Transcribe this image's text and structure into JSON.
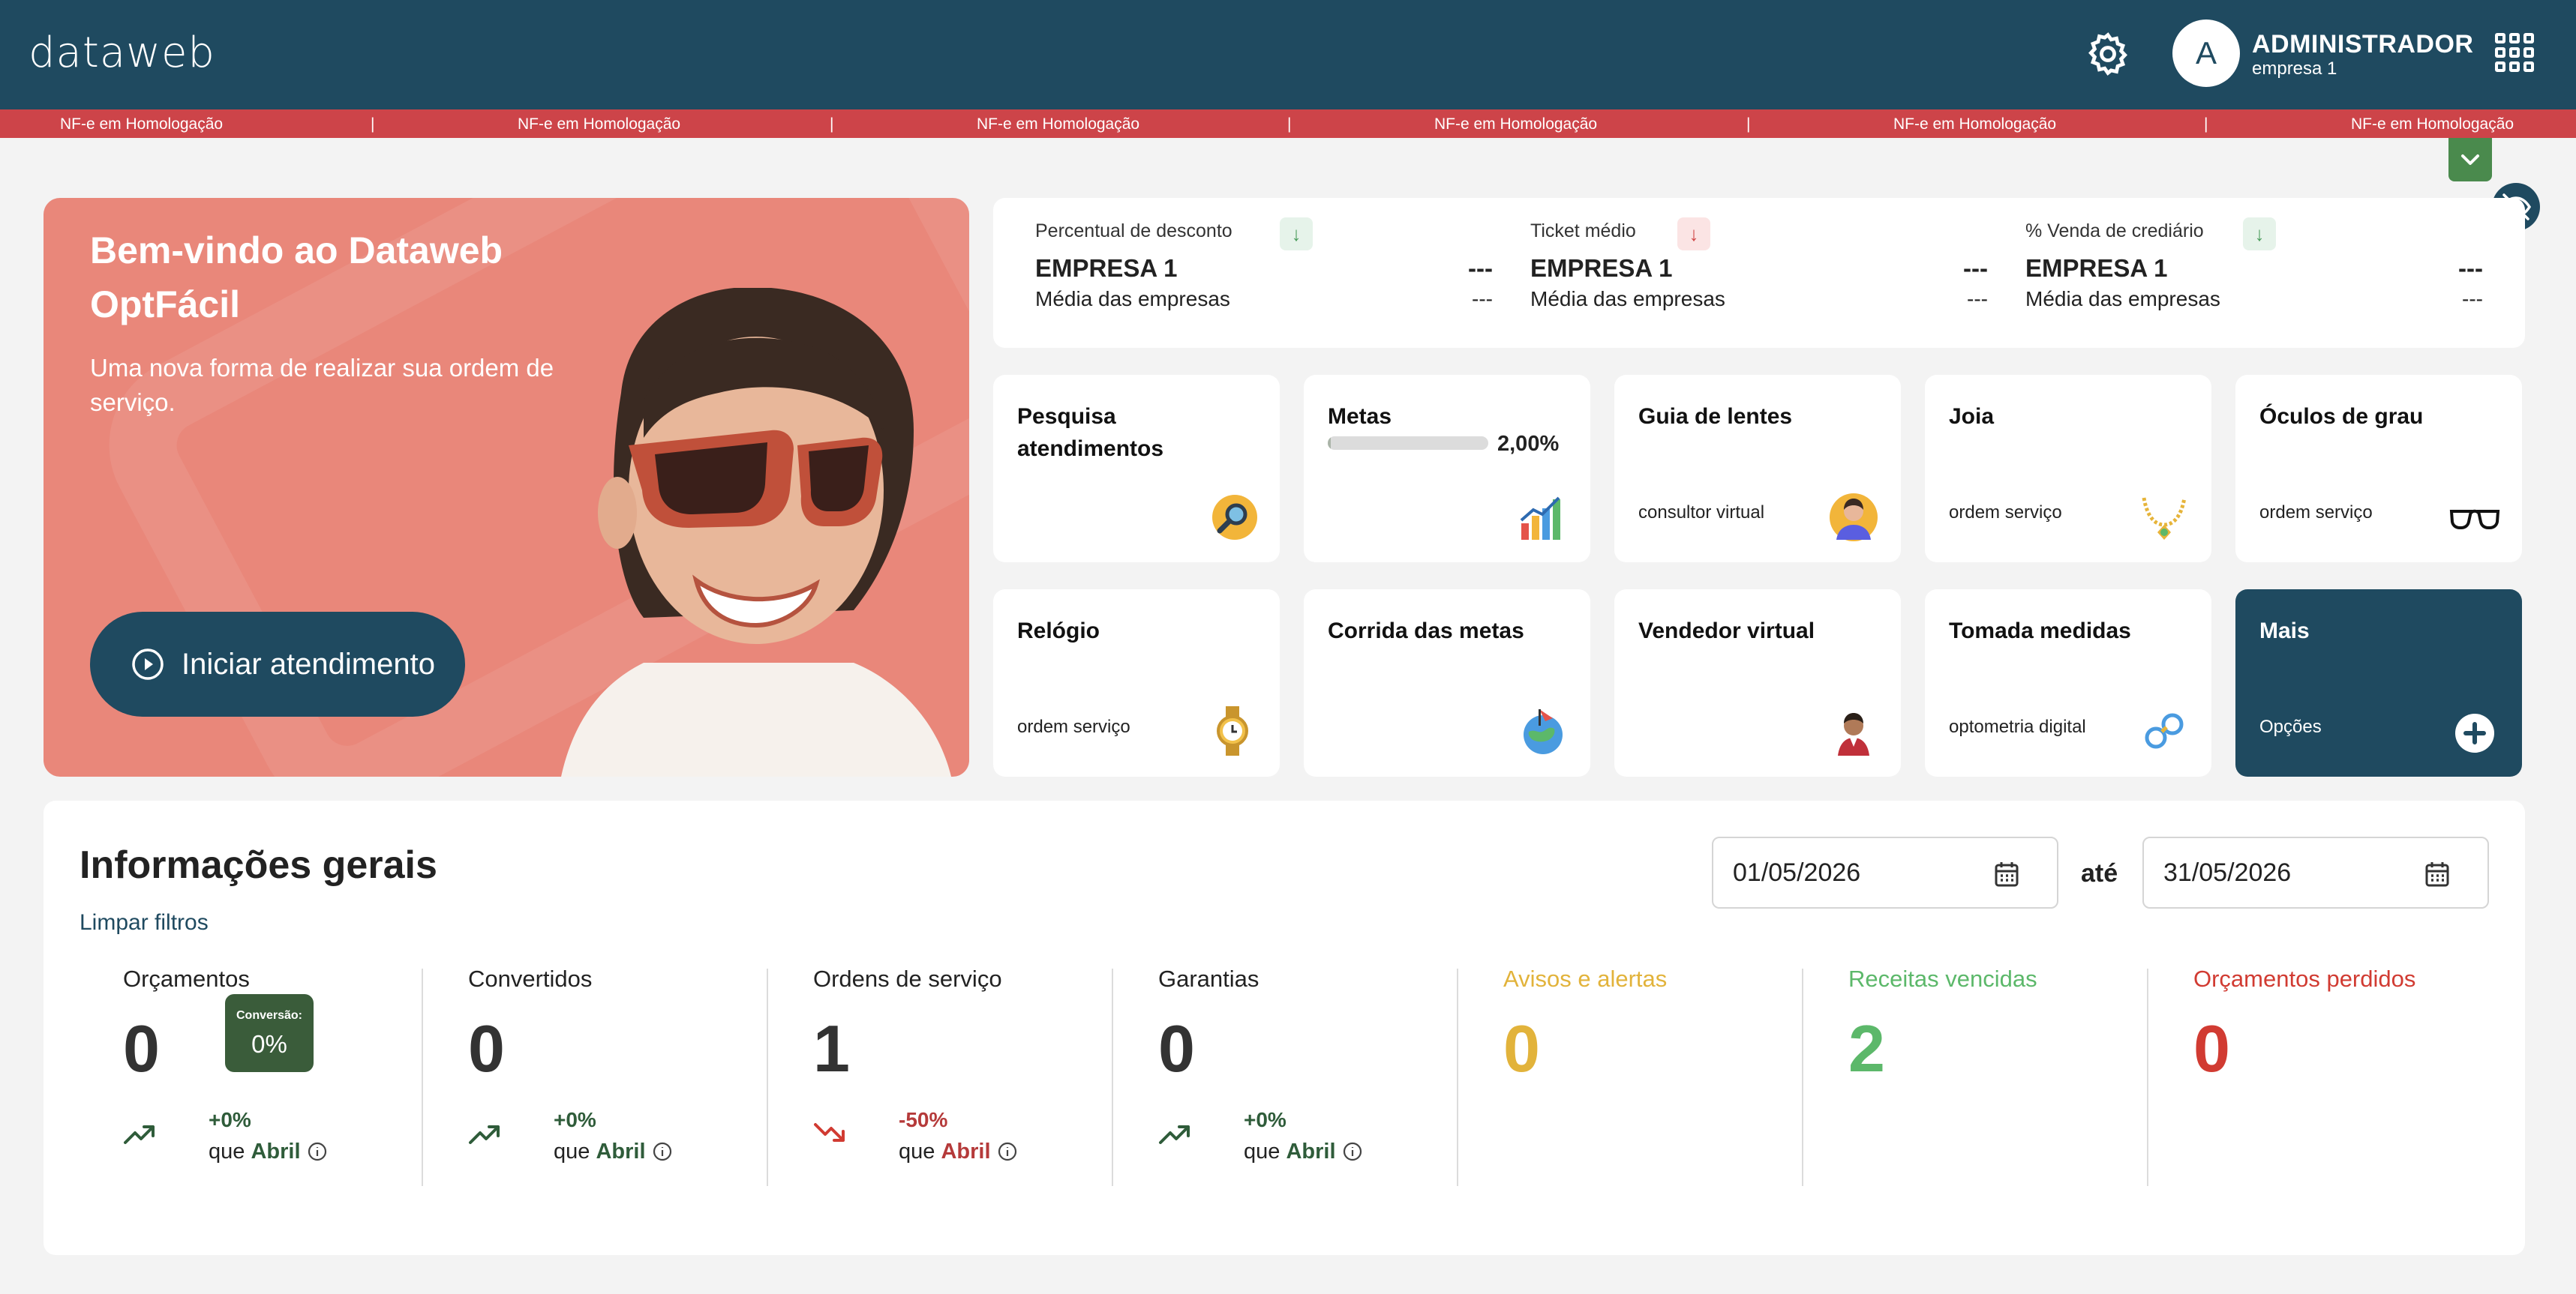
{
  "header": {
    "logo": "dataweb",
    "user_initial": "A",
    "user_name": "ADMINISTRADOR",
    "user_company": "empresa 1"
  },
  "strip": {
    "items": [
      "NF-e em Homologação",
      "NF-e em Homologação",
      "NF-e em Homologação",
      "NF-e em Homologação",
      "NF-e em Homologação",
      "NF-e em Homologação"
    ],
    "separator": "|"
  },
  "hero": {
    "title": "Bem-vindo ao Dataweb OptFácil",
    "subtitle": "Uma nova forma de realizar sua ordem de serviço.",
    "button_label": "Iniciar atendimento"
  },
  "kpis": [
    {
      "label": "Percentual de desconto",
      "company": "EMPRESA 1",
      "company_value": "---",
      "avg_label": "Média das empresas",
      "avg_value": "---",
      "arrow": "↓"
    },
    {
      "label": "Ticket médio",
      "company": "EMPRESA 1",
      "company_value": "---",
      "avg_label": "Média das empresas",
      "avg_value": "---",
      "arrow": "↓"
    },
    {
      "label": "% Venda de crediário",
      "company": "EMPRESA 1",
      "company_value": "---",
      "avg_label": "Média das empresas",
      "avg_value": "---",
      "arrow": "↓"
    }
  ],
  "tiles": {
    "pesquisa": {
      "title": "Pesquisa atendimentos"
    },
    "metas": {
      "title": "Metas",
      "progress": 0.02,
      "progress_label": "2,00%"
    },
    "guia": {
      "title": "Guia de lentes",
      "sub": "consultor virtual"
    },
    "joia": {
      "title": "Joia",
      "sub": "ordem serviço"
    },
    "oculos": {
      "title": "Óculos de grau",
      "sub": "ordem serviço"
    },
    "relogio": {
      "title": "Relógio",
      "sub": "ordem serviço"
    },
    "corrida": {
      "title": "Corrida das metas"
    },
    "vendedor": {
      "title": "Vendedor virtual"
    },
    "tomada": {
      "title": "Tomada medidas",
      "sub": "optometria digital"
    },
    "mais": {
      "title": "Mais",
      "sub": "Opções"
    }
  },
  "info": {
    "title": "Informações gerais",
    "clear_filters": "Limpar filtros",
    "date_from": "01/05/2026",
    "date_to_label": "até",
    "date_to": "31/05/2026",
    "conversion_label": "Conversão:",
    "conversion_value": "0%",
    "stats": [
      {
        "label": "Orçamentos",
        "value": "0",
        "change": "+0%",
        "que": "que",
        "month": "Abril"
      },
      {
        "label": "Convertidos",
        "value": "0",
        "change": "+0%",
        "que": "que",
        "month": "Abril"
      },
      {
        "label": "Ordens de serviço",
        "value": "1",
        "change": "-50%",
        "que": "que",
        "month": "Abril"
      },
      {
        "label": "Garantias",
        "value": "0",
        "change": "+0%",
        "que": "que",
        "month": "Abril"
      },
      {
        "label": "Avisos e alertas",
        "value": "0"
      },
      {
        "label": "Receitas vencidas",
        "value": "2"
      },
      {
        "label": "Orçamentos perdidos",
        "value": "0"
      }
    ]
  },
  "colors": {
    "primary": "#1f4a60",
    "strip": "#cd4449",
    "hero": "#e9877a",
    "avisos": "#e2b33b",
    "receitas": "#5cb86a",
    "perdidos": "#d13b32"
  }
}
